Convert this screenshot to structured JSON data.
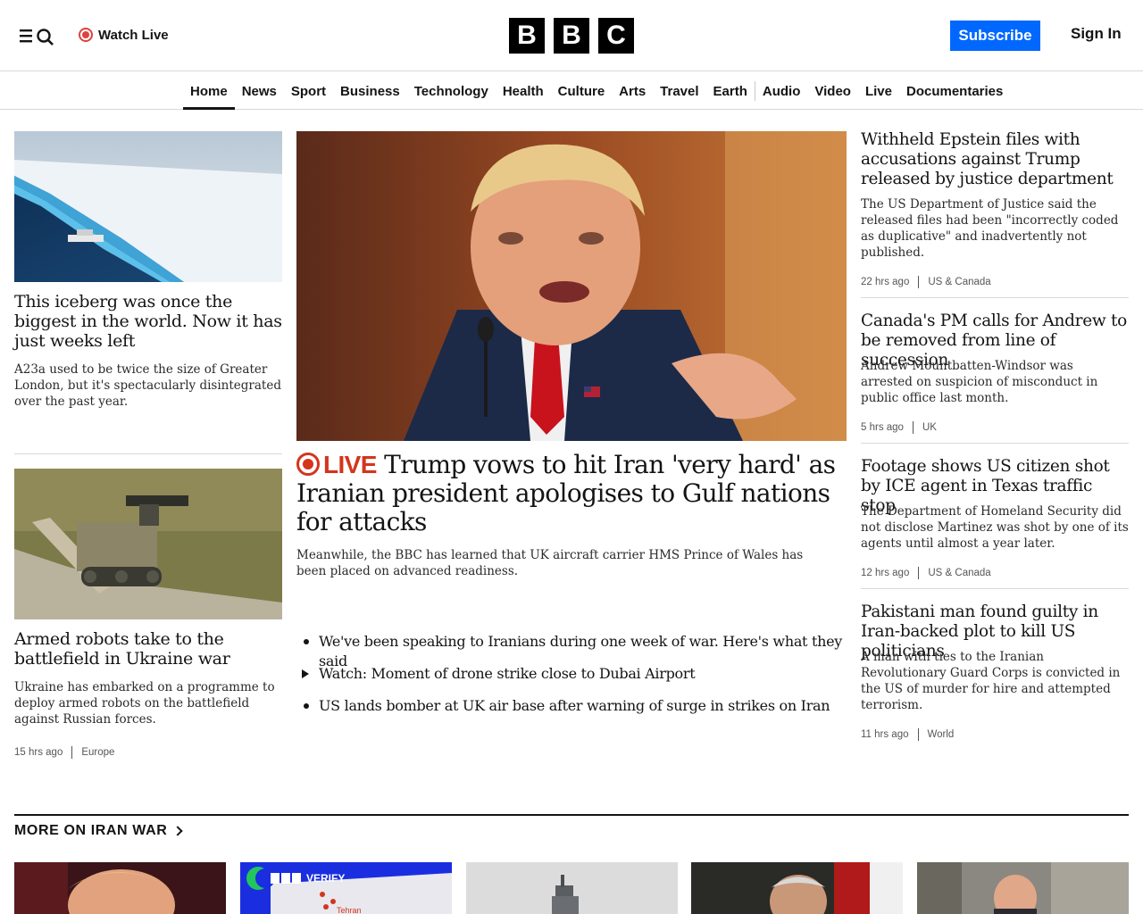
{
  "header": {
    "watch_live": "Watch Live",
    "logo_letters": [
      "B",
      "B",
      "C"
    ],
    "subscribe": "Subscribe",
    "sign_in": "Sign In"
  },
  "nav": {
    "items": [
      "Home",
      "News",
      "Sport",
      "Business",
      "Technology",
      "Health",
      "Culture",
      "Arts",
      "Travel",
      "Earth",
      "Audio",
      "Video",
      "Live",
      "Documentaries"
    ],
    "active": "Home"
  },
  "left": {
    "story1": {
      "headline": "This iceberg was once the biggest in the world. Now it has just weeks left",
      "summary": "A23a used to be twice the size of Greater London, but it's spectacularly disintegrated over the past year."
    },
    "story2": {
      "headline": "Armed robots take to the battlefield in Ukraine war",
      "summary": "Ukraine has embarked on a programme to deploy armed robots on the battlefield against Russian forces.",
      "time": "15 hrs ago",
      "tag": "Europe"
    }
  },
  "main": {
    "live_label": "LIVE",
    "headline": "Trump vows to hit Iran 'very hard' as Iranian president apologises to Gulf nations for attacks",
    "summary": "Meanwhile, the BBC has learned that UK aircraft carrier HMS Prince of Wales has been placed on advanced readiness.",
    "bullets": [
      {
        "text": "We've been speaking to Iranians during one week of war. Here's what they said",
        "icon": "bullet-dot"
      },
      {
        "text": "Watch: Moment of drone strike close to Dubai Airport",
        "icon": "play-icon"
      },
      {
        "text": "US lands bomber at UK air base after warning of surge in strikes on Iran",
        "icon": "bullet-dot"
      }
    ]
  },
  "right": [
    {
      "headline": "Withheld Epstein files with accusations against Trump released by justice department",
      "summary": "The US Department of Justice said the released files had been \"incorrectly coded as duplicative\" and inadvertently not published.",
      "time": "22 hrs ago",
      "tag": "US & Canada"
    },
    {
      "headline": "Canada's PM calls for Andrew to be removed from line of succession",
      "summary": "Andrew Mountbatten-Windsor was arrested on suspicion of misconduct in public office last month.",
      "time": "5 hrs ago",
      "tag": "UK"
    },
    {
      "headline": "Footage shows US citizen shot by ICE agent in Texas traffic stop",
      "summary": "The Department of Homeland Security did not disclose Martinez was shot by one of its agents until almost a year later.",
      "time": "12 hrs ago",
      "tag": "US & Canada"
    },
    {
      "headline": "Pakistani man found guilty in Iran-backed plot to kill US politicians",
      "summary": "A man with ties to the Iranian Revolutionary Guard Corps is convicted in the US of murder for hire and attempted terrorism.",
      "time": "11 hrs ago",
      "tag": "World"
    }
  ],
  "more_section": {
    "title": "MORE ON IRAN WAR",
    "verify_badge": "VERIFY",
    "map_label": "Tehran"
  },
  "colors": {
    "subscribe_bg": "#0068ff",
    "live_red": "#d4351c",
    "verify_blue": "#1a2ee0"
  }
}
